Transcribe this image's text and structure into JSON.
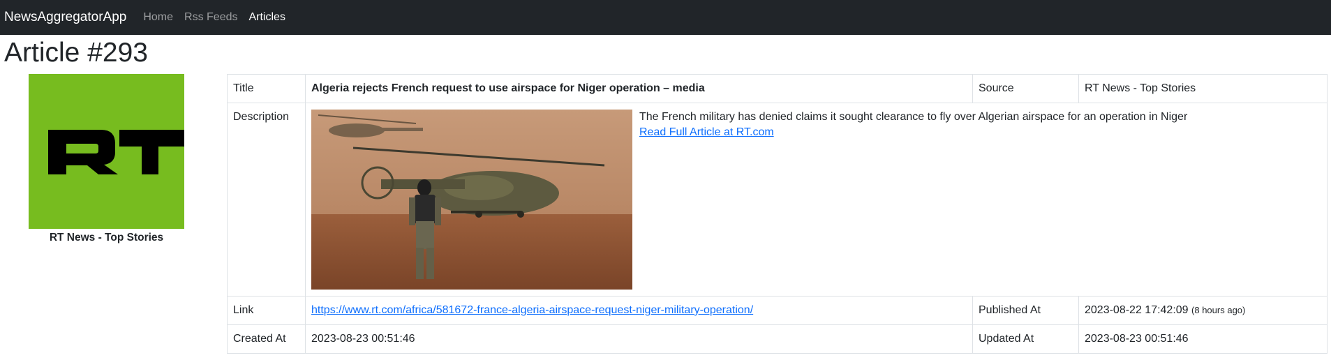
{
  "navbar": {
    "brand": "NewsAggregatorApp",
    "links": [
      {
        "label": "Home",
        "active": false
      },
      {
        "label": "Rss Feeds",
        "active": false
      },
      {
        "label": "Articles",
        "active": true
      }
    ]
  },
  "page": {
    "title": "Article #293"
  },
  "source_card": {
    "logo_text": "RT",
    "logo_color": "#77bc1f",
    "name": "RT News - Top Stories"
  },
  "details": {
    "title_label": "Title",
    "title_value": "Algeria rejects French request to use airspace for Niger operation – media",
    "source_label": "Source",
    "source_value": "RT News - Top Stories",
    "description_label": "Description",
    "description_text": "The French military has denied claims it sought clearance to fly over Algerian airspace for an operation in Niger",
    "read_more_label": "Read Full Article at RT.com",
    "link_label": "Link",
    "link_value": "https://www.rt.com/africa/581672-france-algeria-airspace-request-niger-military-operation/",
    "published_label": "Published At",
    "published_value": "2023-08-22 17:42:09",
    "published_relative": "(8 hours ago)",
    "created_label": "Created At",
    "created_value": "2023-08-23 00:51:46",
    "updated_label": "Updated At",
    "updated_value": "2023-08-23 00:51:46"
  },
  "colors": {
    "navbar_bg": "#212529",
    "link": "#0d6efd",
    "border": "#dee2e6"
  }
}
